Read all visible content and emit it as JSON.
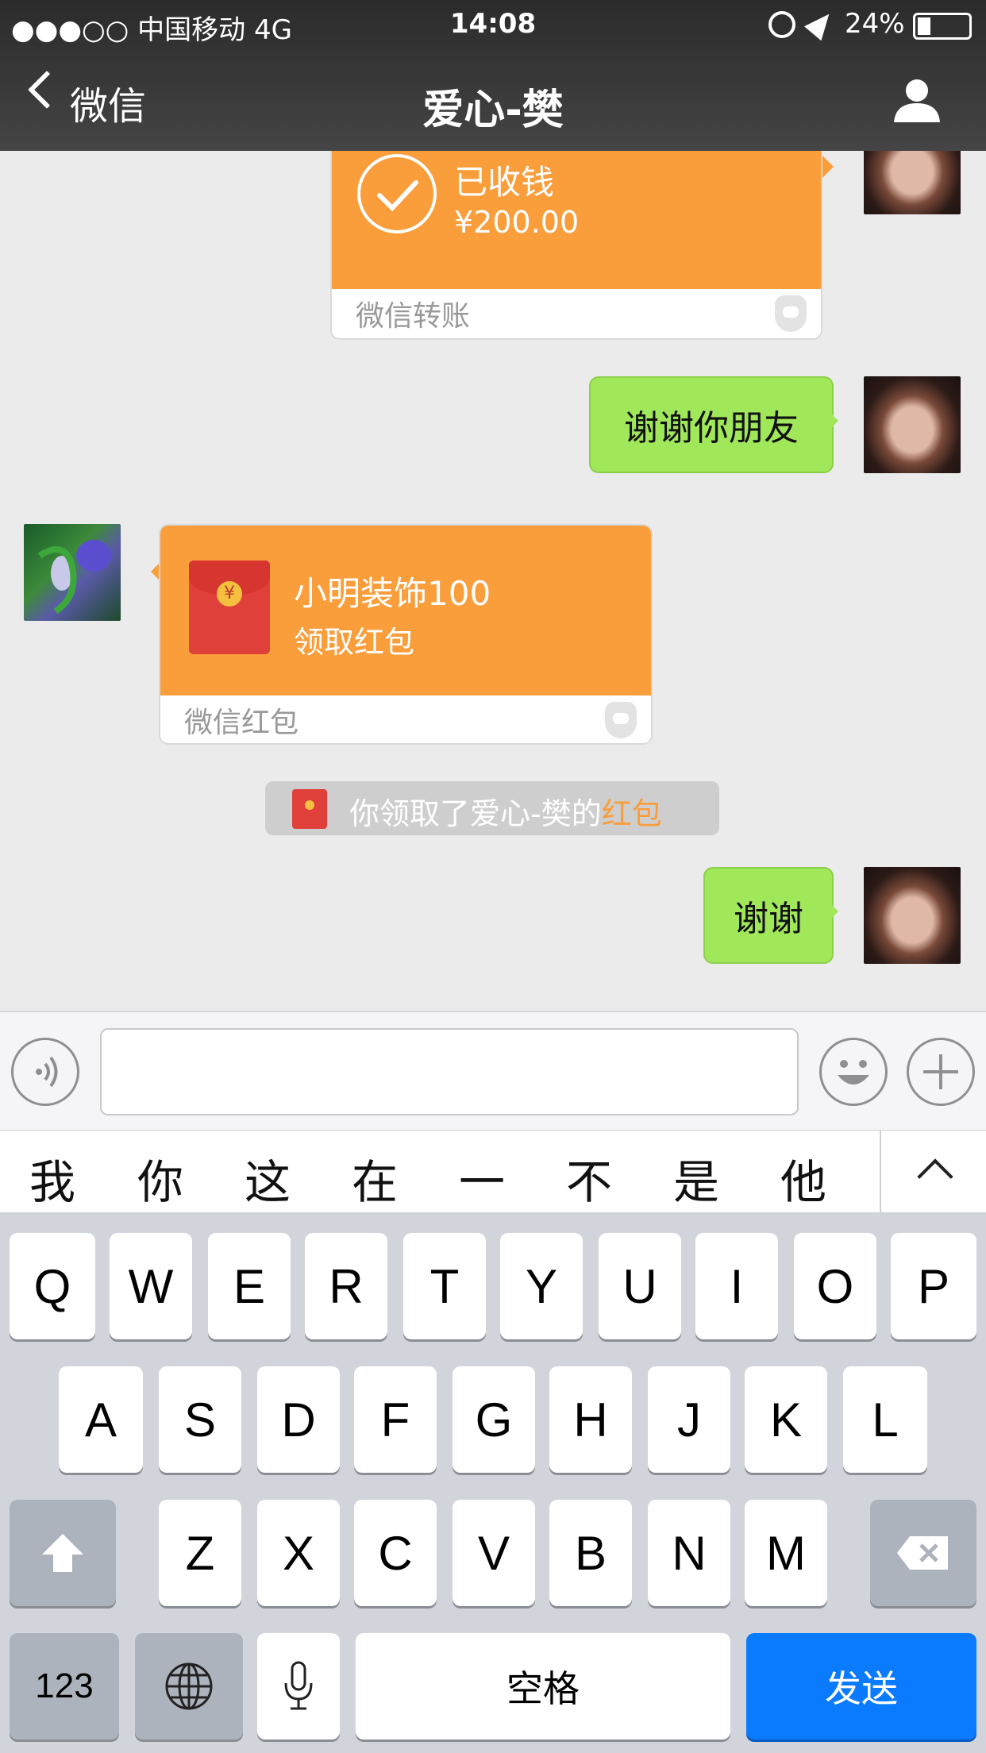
{
  "status_bar": {
    "carrier": "●●●○○ 中国移动  4G",
    "time": "14:08",
    "battery": "24%"
  },
  "nav": {
    "back_label": "微信",
    "title": "爱心-樊"
  },
  "messages": {
    "transfer": {
      "status": "已收钱",
      "amount": "¥200.00",
      "footer": "微信转账"
    },
    "thanks_friend": "谢谢你朋友",
    "red_packet": {
      "title": "小明装饰100",
      "subtitle": "领取红包",
      "footer": "微信红包"
    },
    "system": {
      "prefix": "你领取了爱心-樊的",
      "link": "红包"
    },
    "thanks": "谢谢"
  },
  "candidates": [
    "我",
    "你",
    "这",
    "在",
    "一",
    "不",
    "是",
    "他"
  ],
  "keyboard": {
    "row1": [
      "Q",
      "W",
      "E",
      "R",
      "T",
      "Y",
      "U",
      "I",
      "O",
      "P"
    ],
    "row2": [
      "A",
      "S",
      "D",
      "F",
      "G",
      "H",
      "J",
      "K",
      "L"
    ],
    "row3": [
      "Z",
      "X",
      "C",
      "V",
      "B",
      "N",
      "M"
    ],
    "numbers": "123",
    "space": "空格",
    "send": "发送"
  },
  "colors": {
    "orange": "#fa9d3b",
    "green": "#a0e75a",
    "send_blue": "#0a7aff",
    "link_orange": "#fa9d3b"
  },
  "icons": [
    "back-chevron-icon",
    "profile-icon",
    "checkmark-icon",
    "yuan-icon",
    "voice-icon",
    "emoji-icon",
    "plus-icon",
    "chevron-up-icon",
    "shift-icon",
    "delete-icon",
    "globe-icon",
    "mic-icon",
    "shield-icon"
  ]
}
